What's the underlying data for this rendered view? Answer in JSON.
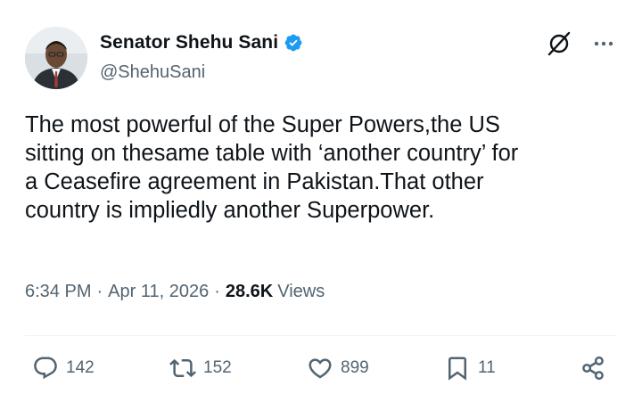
{
  "author": {
    "display_name": "Senator Shehu Sani",
    "handle": "@ShehuSani",
    "verified_color": "#1d9bf0"
  },
  "tweet": {
    "lines": [
      "The most powerful of the Super Powers,the US",
      "sitting on thesame table with ‘another country’ for",
      "a Ceasefire agreement in Pakistan.That other",
      "country is impliedly another Superpower."
    ]
  },
  "meta": {
    "time": "6:34 PM",
    "separator": "·",
    "date": "Apr 11, 2026",
    "views_count": "28.6K",
    "views_label": "Views"
  },
  "actions": {
    "replies": "142",
    "reposts": "152",
    "likes": "899",
    "bookmarks": "11"
  },
  "icons": [
    "verified-badge-icon",
    "grok-icon",
    "more-icon",
    "reply-icon",
    "repost-icon",
    "like-icon",
    "bookmark-icon",
    "share-icon"
  ]
}
